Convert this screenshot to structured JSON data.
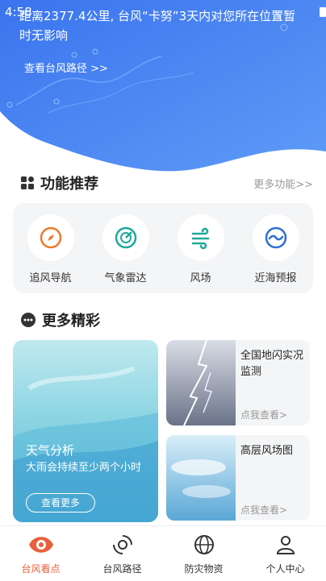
{
  "status": {
    "time": "4:58"
  },
  "alert": {
    "text": "距离2377.4公里, 台风“卡努”3天内对您所在位置暂时无影响",
    "route_link": "查看台风路径 >>"
  },
  "features": {
    "title": "功能推荐",
    "more": "更多功能>>",
    "items": [
      {
        "label": "追风导航",
        "icon": "compass-icon"
      },
      {
        "label": "气象雷达",
        "icon": "radar-icon"
      },
      {
        "label": "风场",
        "icon": "wind-icon"
      },
      {
        "label": "近海预报",
        "icon": "sea-forecast-icon"
      }
    ]
  },
  "highlights": {
    "title": "更多精彩",
    "weather_card": {
      "title": "天气分析",
      "subtitle": "大雨会持续至少两个小时",
      "button": "查看更多"
    },
    "cards": [
      {
        "title": "全国地闪实况监测",
        "link": "点我查看>",
        "icon": "lightning-image"
      },
      {
        "title": "高层风场图",
        "link": "点我查看>",
        "icon": "sky-image"
      }
    ]
  },
  "tabbar": {
    "items": [
      {
        "label": "台风看点",
        "icon": "typhoon-eye-icon",
        "active": true
      },
      {
        "label": "台风路径",
        "icon": "typhoon-path-icon"
      },
      {
        "label": "防灾物资",
        "icon": "globe-icon"
      },
      {
        "label": "个人中心",
        "icon": "user-icon"
      }
    ]
  },
  "colors": {
    "hero_blue": "#3f7df0",
    "accent_orange": "#e8603c",
    "teal": "#1fa89a",
    "card_bg": "#f4f5f7"
  }
}
